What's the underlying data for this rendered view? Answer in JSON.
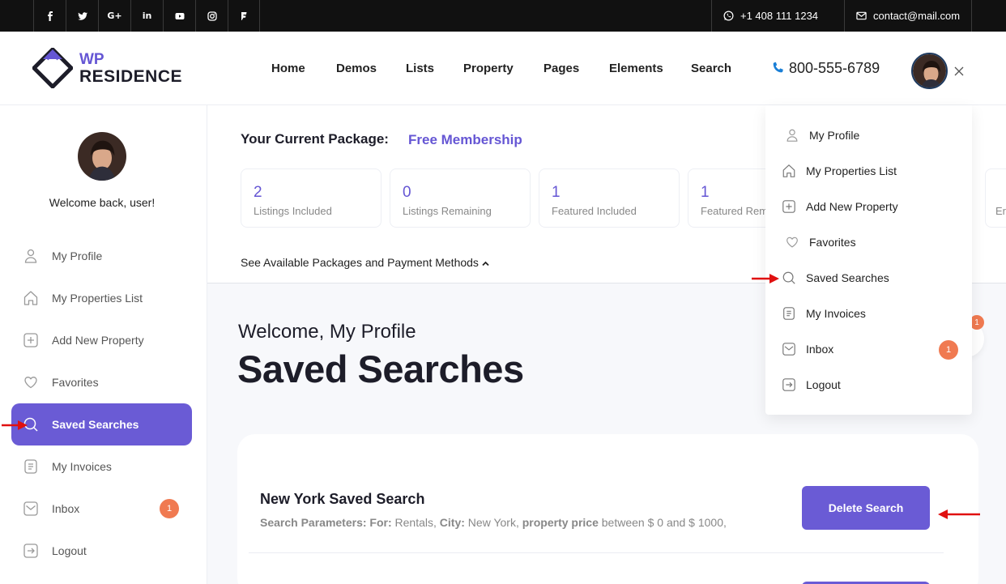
{
  "topbar": {
    "social_icons": [
      "facebook-icon",
      "twitter-icon",
      "google-plus-icon",
      "linkedin-icon",
      "youtube-icon",
      "instagram-icon",
      "foursquare-icon"
    ],
    "google_plus_text": "G+",
    "linkedin_text": "in",
    "phone": "+1 408 111 1234",
    "email": "contact@mail.com"
  },
  "header": {
    "logo_line1": "WP",
    "logo_line2": "RESIDENCE",
    "nav": [
      "Home",
      "Demos",
      "Lists",
      "Property",
      "Pages",
      "Elements",
      "Search"
    ],
    "phone": "800-555-6789"
  },
  "sidebar": {
    "welcome": "Welcome back, user!",
    "items": [
      {
        "label": "My Profile",
        "icon": "user-icon"
      },
      {
        "label": "My Properties List",
        "icon": "home-icon"
      },
      {
        "label": "Add New Property",
        "icon": "plus-square-icon"
      },
      {
        "label": "Favorites",
        "icon": "heart-icon"
      },
      {
        "label": "Saved Searches",
        "icon": "search-icon",
        "active": true
      },
      {
        "label": "My Invoices",
        "icon": "invoice-icon"
      },
      {
        "label": "Inbox",
        "icon": "mail-icon",
        "badge": "1"
      },
      {
        "label": "Logout",
        "icon": "logout-icon"
      }
    ]
  },
  "package": {
    "label": "Your Current Package:",
    "name": "Free Membership",
    "stats": [
      {
        "value": "2",
        "label": "Listings Included"
      },
      {
        "value": "0",
        "label": "Listings Remaining"
      },
      {
        "value": "1",
        "label": "Featured Included"
      },
      {
        "value": "1",
        "label": "Featured Rem"
      },
      {
        "value": "",
        "label": "Er"
      }
    ],
    "see_link": "See Available Packages and Payment Methods"
  },
  "main": {
    "welcome": "Welcome, My Profile",
    "title": "Saved Searches",
    "background_badge": "1",
    "searches": [
      {
        "title": "New York Saved Search",
        "params_label": "Search Parameters:",
        "for_label": "For:",
        "for_value": "Rentals,",
        "city_label": "City:",
        "city_value": "New York,",
        "price_label": "property price",
        "price_value": "between $ 0 and $ 1000,",
        "button": "Delete Search"
      }
    ]
  },
  "dropdown": {
    "items": [
      {
        "label": "My Profile",
        "icon": "user-icon"
      },
      {
        "label": "My Properties List",
        "icon": "home-icon"
      },
      {
        "label": "Add New Property",
        "icon": "plus-square-icon"
      },
      {
        "label": "Favorites",
        "icon": "heart-icon"
      },
      {
        "label": "Saved Searches",
        "icon": "search-icon"
      },
      {
        "label": "My Invoices",
        "icon": "invoice-icon"
      },
      {
        "label": "Inbox",
        "icon": "mail-icon",
        "badge": "1"
      },
      {
        "label": "Logout",
        "icon": "logout-icon"
      }
    ]
  },
  "colors": {
    "accent": "#6a5bd5",
    "badge": "#f07a51",
    "annotation_arrow": "#e01010"
  }
}
